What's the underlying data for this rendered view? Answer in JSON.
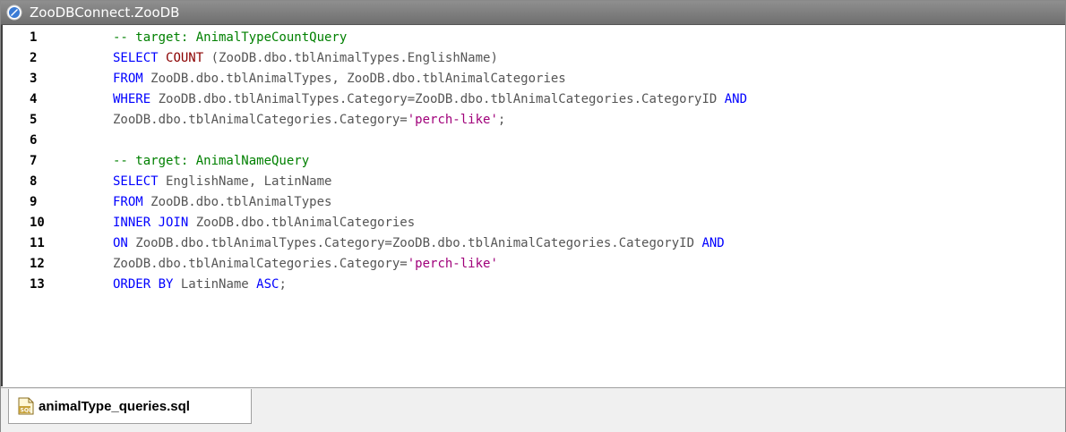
{
  "window": {
    "title": "ZooDBConnect.ZooDB",
    "icon": "database-connection-icon"
  },
  "editor": {
    "lines": [
      {
        "n": "1",
        "tokens": [
          [
            "cm",
            "-- target: AnimalTypeCountQuery"
          ]
        ]
      },
      {
        "n": "2",
        "tokens": [
          [
            "kw",
            "SELECT"
          ],
          [
            "op",
            " "
          ],
          [
            "fn",
            "COUNT"
          ],
          [
            "op",
            " (ZooDB.dbo.tblAnimalTypes.EnglishName)"
          ]
        ]
      },
      {
        "n": "3",
        "tokens": [
          [
            "kw",
            "FROM"
          ],
          [
            "op",
            " ZooDB.dbo.tblAnimalTypes, ZooDB.dbo.tblAnimalCategories"
          ]
        ]
      },
      {
        "n": "4",
        "tokens": [
          [
            "kw",
            "WHERE"
          ],
          [
            "op",
            " ZooDB.dbo.tblAnimalTypes.Category=ZooDB.dbo.tblAnimalCategories.CategoryID "
          ],
          [
            "kw",
            "AND"
          ]
        ]
      },
      {
        "n": "5",
        "tokens": [
          [
            "op",
            "ZooDB.dbo.tblAnimalCategories.Category="
          ],
          [
            "st",
            "'perch-like'"
          ],
          [
            "op",
            ";"
          ]
        ]
      },
      {
        "n": "6",
        "tokens": []
      },
      {
        "n": "7",
        "tokens": [
          [
            "cm",
            "-- target: AnimalNameQuery"
          ]
        ]
      },
      {
        "n": "8",
        "tokens": [
          [
            "kw",
            "SELECT"
          ],
          [
            "op",
            " EnglishName, LatinName"
          ]
        ]
      },
      {
        "n": "9",
        "tokens": [
          [
            "kw",
            "FROM"
          ],
          [
            "op",
            " ZooDB.dbo.tblAnimalTypes"
          ]
        ]
      },
      {
        "n": "10",
        "tokens": [
          [
            "kw",
            "INNER JOIN"
          ],
          [
            "op",
            " ZooDB.dbo.tblAnimalCategories"
          ]
        ]
      },
      {
        "n": "11",
        "tokens": [
          [
            "kw",
            "ON"
          ],
          [
            "op",
            " ZooDB.dbo.tblAnimalTypes.Category=ZooDB.dbo.tblAnimalCategories.CategoryID "
          ],
          [
            "kw",
            "AND"
          ]
        ]
      },
      {
        "n": "12",
        "tokens": [
          [
            "op",
            "ZooDB.dbo.tblAnimalCategories.Category="
          ],
          [
            "st",
            "'perch-like'"
          ]
        ]
      },
      {
        "n": "13",
        "tokens": [
          [
            "kw",
            "ORDER BY"
          ],
          [
            "op",
            " LatinName "
          ],
          [
            "kw",
            "ASC"
          ],
          [
            "op",
            ";"
          ]
        ]
      }
    ]
  },
  "tabs": [
    {
      "label": "animalType_queries.sql",
      "icon": "sql-file-icon"
    }
  ],
  "colors": {
    "keyword": "#0000ff",
    "function": "#8b0000",
    "comment": "#008000",
    "identifier": "#555555",
    "string": "#a0007a",
    "titlebar": "#7a7a7a"
  }
}
